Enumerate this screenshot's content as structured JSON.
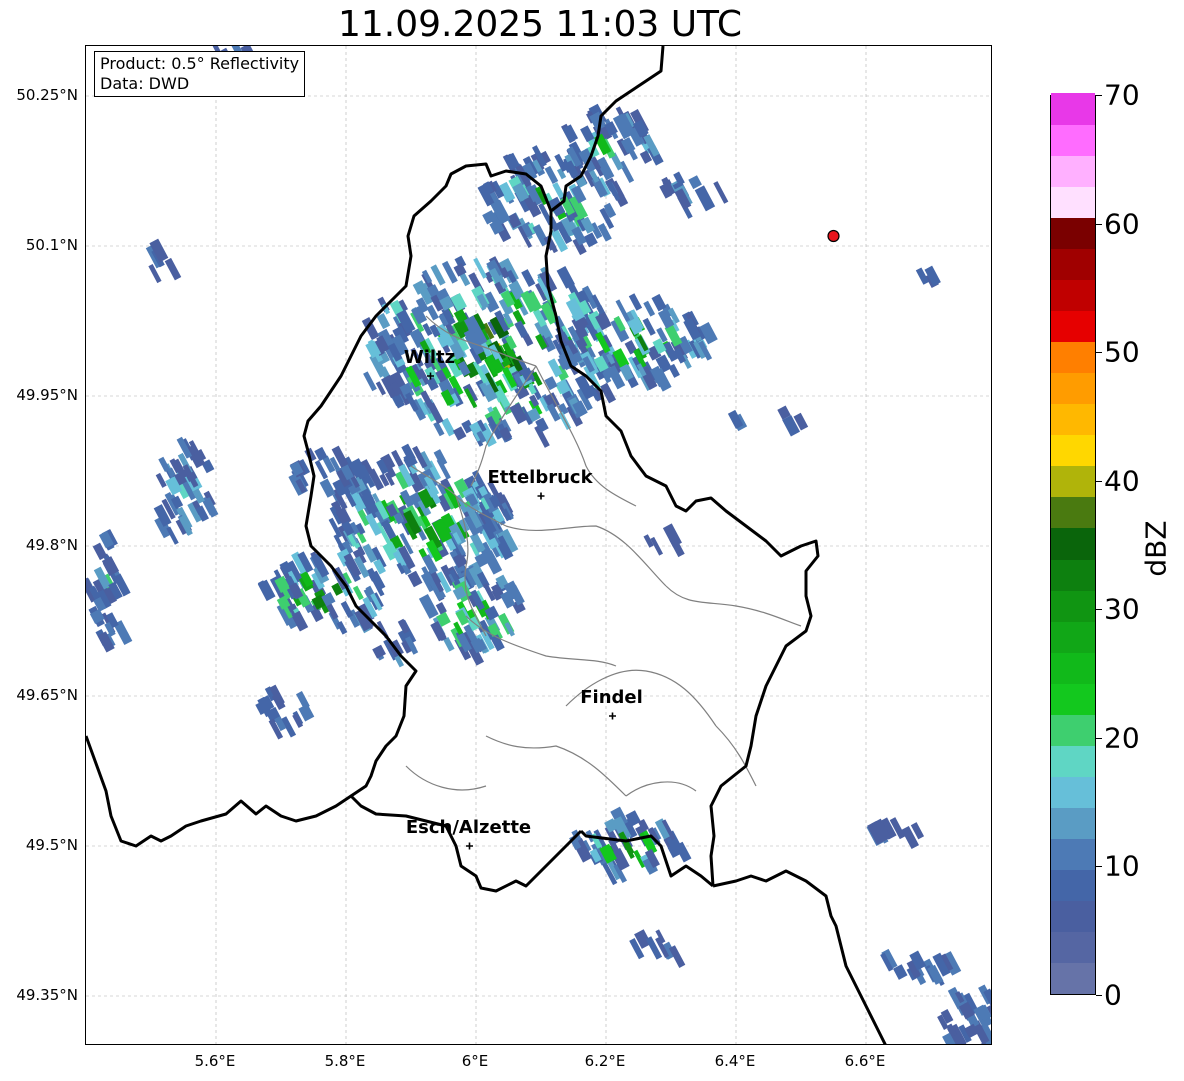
{
  "title": "11.09.2025 11:03 UTC",
  "info_box": {
    "line1": "Product: 0.5° Reflectivity",
    "line2": "Data: DWD"
  },
  "lat_labels": [
    "50.25°N",
    "50.1°N",
    "49.95°N",
    "49.8°N",
    "49.65°N",
    "49.5°N",
    "49.35°N"
  ],
  "lon_labels": [
    "5.6°E",
    "5.8°E",
    "6°E",
    "6.2°E",
    "6.4°E",
    "6.6°E"
  ],
  "cities": [
    {
      "name": "Wiltz",
      "lon": 5.93,
      "lat": 49.97
    },
    {
      "name": "Ettelbruck",
      "lon": 6.1,
      "lat": 49.85
    },
    {
      "name": "Findel",
      "lon": 6.21,
      "lat": 49.63
    },
    {
      "name": "Esch/Alzette",
      "lon": 5.99,
      "lat": 49.5
    }
  ],
  "radar_site_marker": {
    "lon": 6.55,
    "lat": 50.11,
    "color": "#e8141c"
  },
  "colorbar": {
    "label": "dBZ",
    "ticks": [
      "0",
      "10",
      "20",
      "30",
      "40",
      "50",
      "60",
      "70"
    ],
    "colors": [
      "#6673a8",
      "#5566a3",
      "#4a5fa0",
      "#4466a8",
      "#4d7ab5",
      "#5a9cc4",
      "#66bfd9",
      "#5fd6c4",
      "#3ecf6f",
      "#13c81e",
      "#11b91a",
      "#11a717",
      "#109512",
      "#0d800f",
      "#0a650b",
      "#4a7a10",
      "#b0b40a",
      "#ffd700",
      "#ffb800",
      "#ff9c00",
      "#ff7f00",
      "#e60000",
      "#c00000",
      "#a00000",
      "#7a0000",
      "#ffe0ff",
      "#ffb0ff",
      "#ff6cff",
      "#e838e8"
    ]
  }
}
